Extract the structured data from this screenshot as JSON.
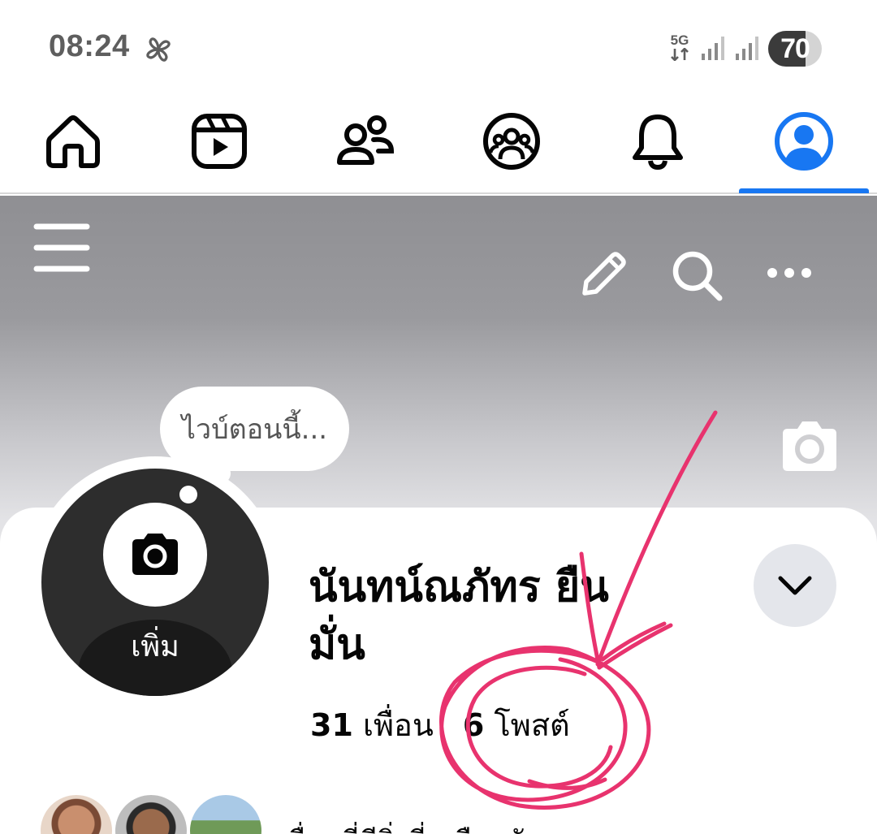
{
  "status_bar": {
    "time": "08:24",
    "network_type": "5G",
    "battery_level": "70",
    "battery_fraction": 0.7,
    "icons": [
      "pinwheel-icon",
      "data-arrows-icon",
      "signal-icon",
      "signal-icon",
      "battery-icon"
    ]
  },
  "nav": {
    "items": [
      {
        "name": "home",
        "icon": "home-icon"
      },
      {
        "name": "reels",
        "icon": "reels-icon"
      },
      {
        "name": "friends",
        "icon": "friends-icon"
      },
      {
        "name": "groups",
        "icon": "groups-icon"
      },
      {
        "name": "notifications",
        "icon": "bell-icon"
      },
      {
        "name": "profile",
        "icon": "profile-icon",
        "active": true
      }
    ],
    "active_color": "#1877f2"
  },
  "cover": {
    "icons": [
      "menu-icon",
      "edit-icon",
      "search-icon",
      "more-icon",
      "camera-icon"
    ]
  },
  "profile": {
    "vibe_placeholder": "ไวบ์ตอนนี้...",
    "avatar_add_label": "เพิ่ม",
    "name_line1": "นันทน์ณภัทร ยืน",
    "name_line2": "มั่น",
    "friends_count": "31",
    "friends_label": "เพื่อน",
    "posts_count": "6",
    "posts_label": "โพสต์"
  },
  "mutual": {
    "text": "เพื่อนที่มีสิ่งที่เหมือนกัน"
  },
  "colors": {
    "accent": "#1877f2",
    "annotation": "#e8336e"
  }
}
